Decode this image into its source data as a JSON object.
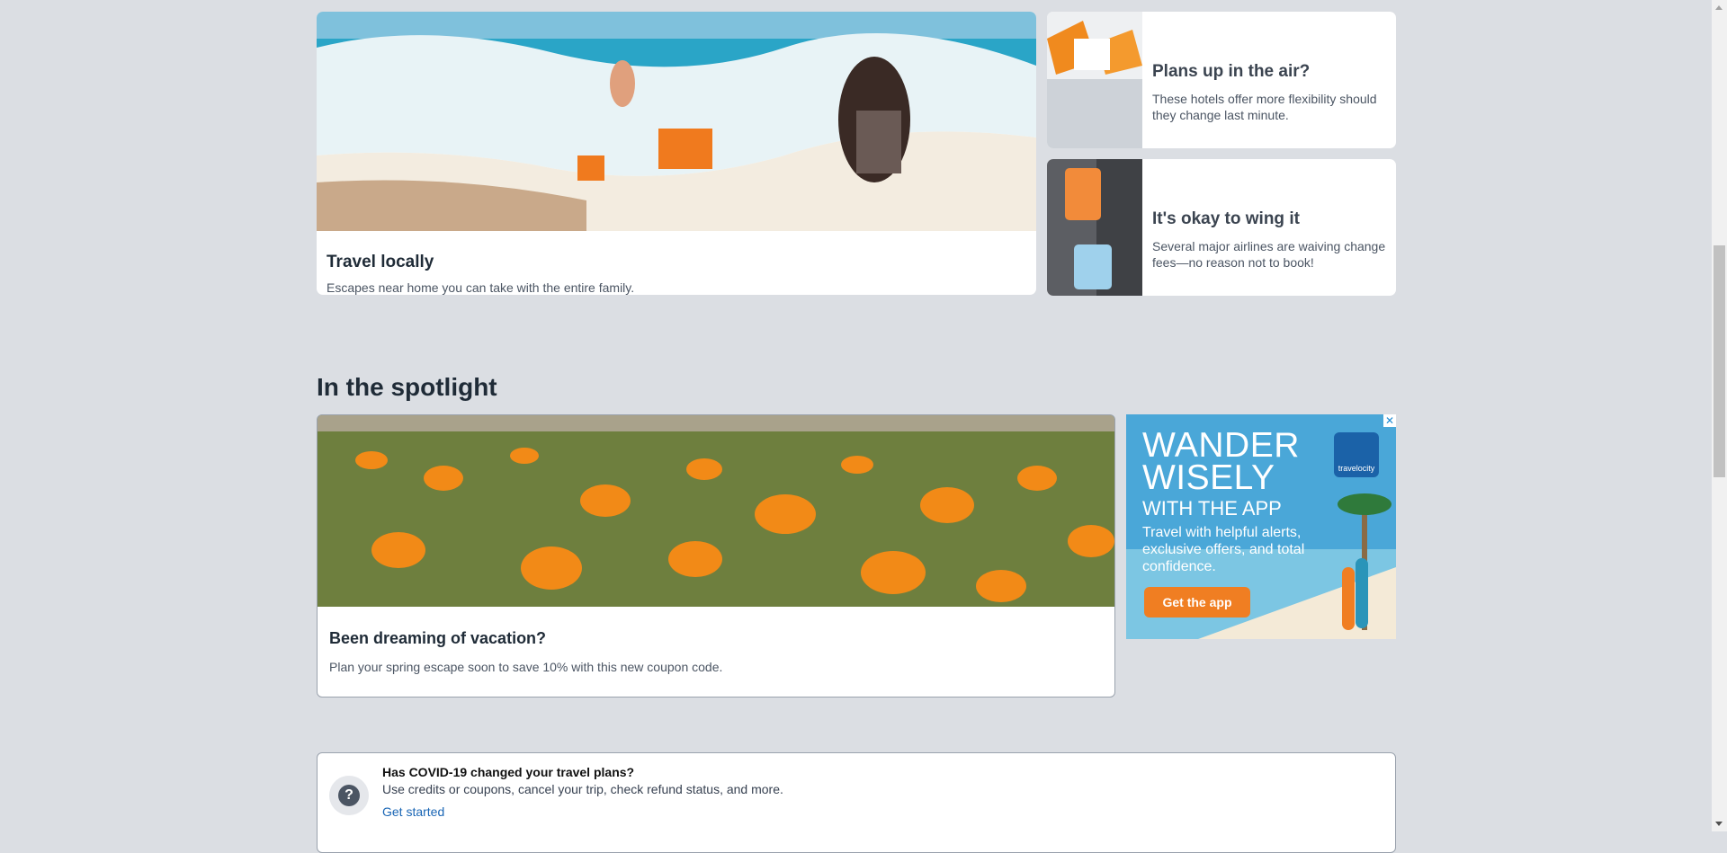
{
  "cards": {
    "hero": {
      "title": "Travel locally",
      "description": "Escapes near home you can take with the entire family."
    },
    "flex": {
      "title": "Plans up in the air?",
      "description": "These hotels offer more flexibility should they change last minute."
    },
    "airlines": {
      "title": "It's okay to wing it",
      "description": "Several major airlines are waiving change fees—no reason not to book!"
    }
  },
  "spotlight": {
    "heading": "In the spotlight",
    "card": {
      "title": "Been dreaming of vacation?",
      "description": "Plan your spring escape soon to save 10% with this new coupon code."
    }
  },
  "ad": {
    "close": "✕",
    "headline": "WANDER WISELY",
    "subheadline": "WITH THE APP",
    "body": "Travel with helpful alerts, exclusive offers, and total confidence.",
    "cta": "Get the app",
    "brand": "travelocity"
  },
  "covid": {
    "title": "Has COVID-19 changed your travel plans?",
    "description": "Use credits or coupons, cancel your trip, check refund status, and more.",
    "link": "Get started",
    "icon": "?"
  },
  "colors": {
    "page_bg": "#dbdee3",
    "link": "#1a66b5",
    "ad_cta": "#f07e22"
  }
}
